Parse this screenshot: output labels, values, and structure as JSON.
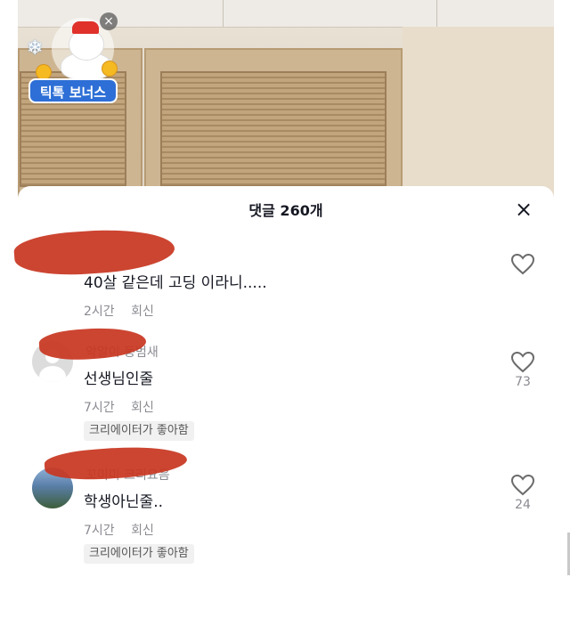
{
  "bonus": {
    "label": "틱톡 보너스",
    "close": "×"
  },
  "comments_panel": {
    "title": "댓글 260개",
    "close": "×"
  },
  "comments": [
    {
      "username": "",
      "text": "40살 같은데    고딩 이라니.....",
      "time": "2시간",
      "reply": "회신",
      "badge": "",
      "likes": ""
    },
    {
      "username": "악알이 동범새",
      "text": "선생님인줄",
      "time": "7시간",
      "reply": "회신",
      "badge": "크리에이터가 좋아함",
      "likes": "73"
    },
    {
      "username": "꼬미미 크리요음",
      "text": "학생아닌줄..",
      "time": "7시간",
      "reply": "회신",
      "badge": "크리에이터가 좋아함",
      "likes": "24"
    }
  ],
  "icons": {
    "like": "heart-outline-icon",
    "close": "close-icon",
    "avatar": "default-avatar-icon"
  },
  "colors": {
    "redaction": "#c8351f",
    "text": "#161823",
    "muted": "#8a8b91",
    "bonus_blue": "#2d6fd6"
  }
}
